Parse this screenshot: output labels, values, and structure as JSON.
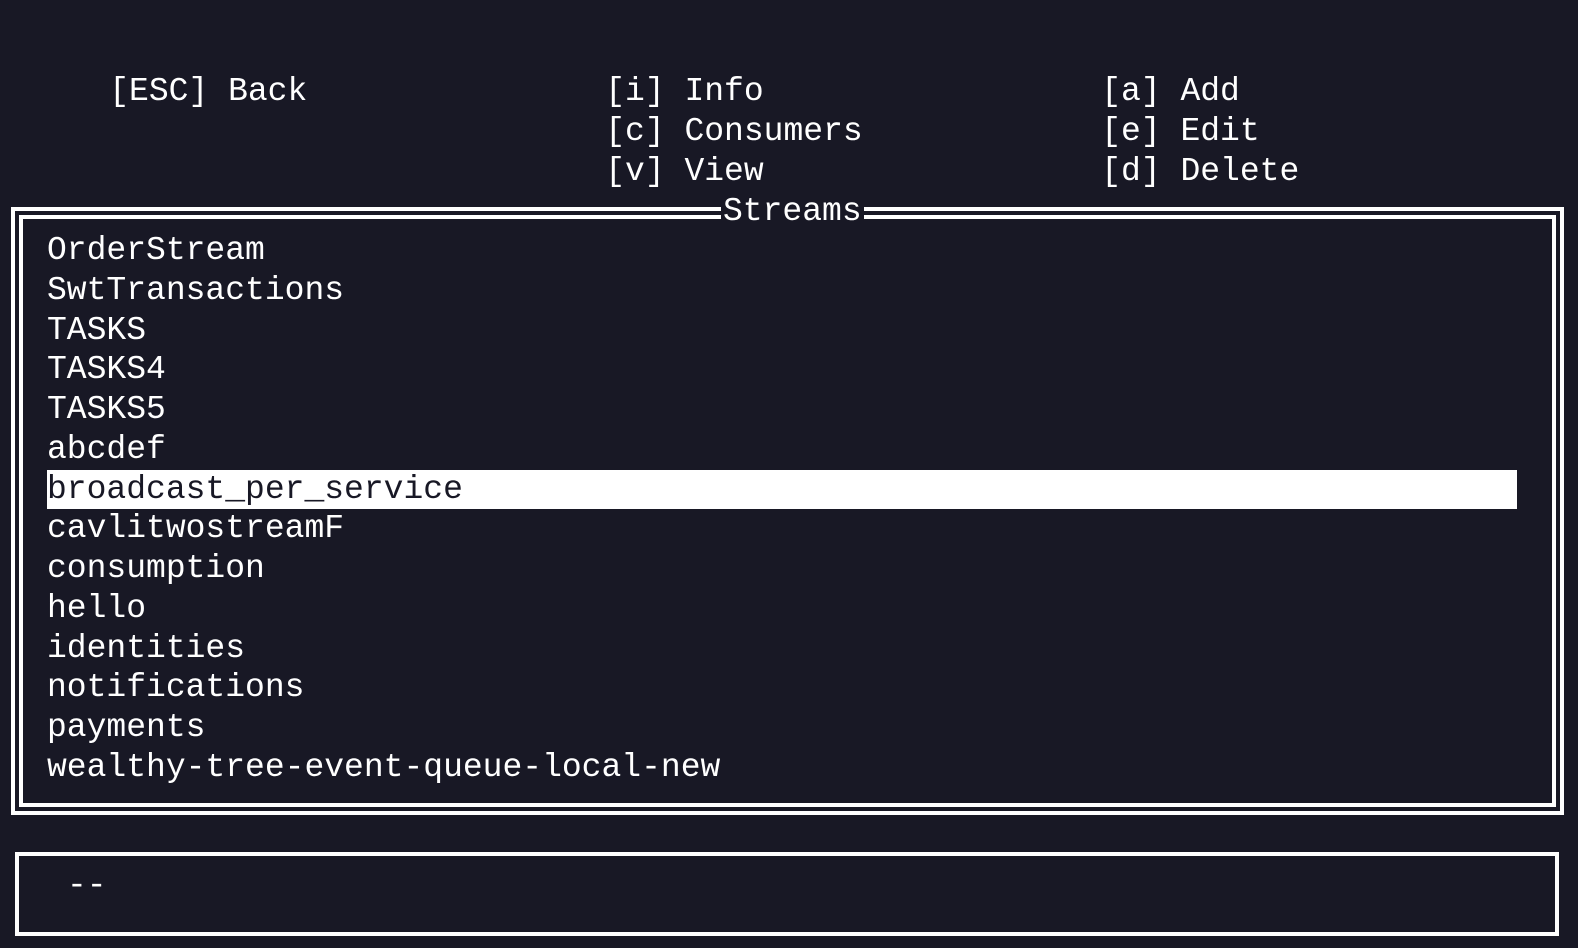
{
  "header": {
    "col1": [
      {
        "key": "[ESC]",
        "label": "Back"
      }
    ],
    "col2": [
      {
        "key": "[i]",
        "label": "Info"
      },
      {
        "key": "[c]",
        "label": "Consumers"
      },
      {
        "key": "[v]",
        "label": "View"
      }
    ],
    "col3": [
      {
        "key": "[a]",
        "label": "Add"
      },
      {
        "key": "[e]",
        "label": "Edit"
      },
      {
        "key": "[d]",
        "label": "Delete"
      }
    ]
  },
  "panel": {
    "title": "Streams",
    "selected_index": 6,
    "items": [
      "OrderStream",
      "SwtTransactions",
      "TASKS",
      "TASKS4",
      "TASKS5",
      "abcdef",
      "broadcast_per_service",
      "cavlitwostreamF",
      "consumption",
      "hello",
      "identities",
      "notifications",
      "payments",
      "wealthy-tree-event-queue-local-new"
    ]
  },
  "status": {
    "text": "--"
  },
  "colors": {
    "background": "#181825",
    "foreground": "#ffffff",
    "selection_bg": "#ffffff",
    "selection_fg": "#181825"
  }
}
